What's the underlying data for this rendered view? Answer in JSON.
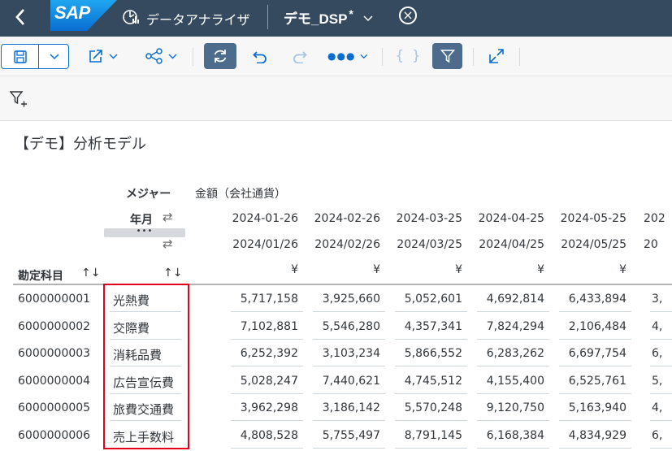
{
  "shell": {
    "back_icon": "chevron-left-icon",
    "logo": "SAP",
    "app_title": "データアナライザ",
    "doc_title": "デモ_DSP",
    "dirty_marker": "*",
    "colors": {
      "shell_bg": "#354a5f",
      "accent": "#0a6ed1",
      "highlight_box": "#e2001a"
    }
  },
  "toolbar": {
    "items": [
      "save-icon",
      "dropdown",
      "share-icon",
      "network-icon",
      "refresh-icon",
      "undo-icon",
      "redo-icon",
      "more-icon",
      "code-icon",
      "filter-icon",
      "fullscreen-icon"
    ]
  },
  "filterbar": {
    "icon": "add-filter-icon"
  },
  "model_title": "【デモ】分析モデル",
  "table": {
    "measure_label": "メジャー",
    "measure_value": "金額（会社通貨）",
    "month_label": "年月",
    "dots": "•••",
    "account_label": "勘定科目",
    "sort_icon": "↑↓",
    "dates1": [
      "2024-01-26",
      "2024-02-26",
      "2024-03-25",
      "2024-04-25",
      "2024-05-25",
      "202"
    ],
    "dates2": [
      "2024/01/26",
      "2024/02/26",
      "2024/03/25",
      "2024/04/25",
      "2024/05/25",
      "20"
    ],
    "currency": [
      "¥",
      "¥",
      "¥",
      "¥",
      "¥"
    ],
    "rows": [
      {
        "account": "6000000001",
        "name": "光熱費",
        "values": [
          "5,717,158",
          "3,925,660",
          "5,052,601",
          "4,692,814",
          "6,433,894"
        ],
        "partial": "3,"
      },
      {
        "account": "6000000002",
        "name": "交際費",
        "values": [
          "7,102,881",
          "5,546,280",
          "4,357,341",
          "7,824,294",
          "2,106,484"
        ],
        "partial": "4,"
      },
      {
        "account": "6000000003",
        "name": "消耗品費",
        "values": [
          "6,252,392",
          "3,103,234",
          "5,866,552",
          "6,283,262",
          "6,697,754"
        ],
        "partial": "6,"
      },
      {
        "account": "6000000004",
        "name": "広告宣伝費",
        "values": [
          "5,028,247",
          "7,440,621",
          "4,745,512",
          "4,155,400",
          "6,525,761"
        ],
        "partial": "5,"
      },
      {
        "account": "6000000005",
        "name": "旅費交通費",
        "values": [
          "3,962,298",
          "3,186,142",
          "5,570,248",
          "9,120,750",
          "5,163,940"
        ],
        "partial": "4,"
      },
      {
        "account": "6000000006",
        "name": "売上手数料",
        "values": [
          "4,808,528",
          "5,755,497",
          "8,791,145",
          "6,168,384",
          "4,834,929"
        ],
        "partial": "6,"
      }
    ]
  }
}
